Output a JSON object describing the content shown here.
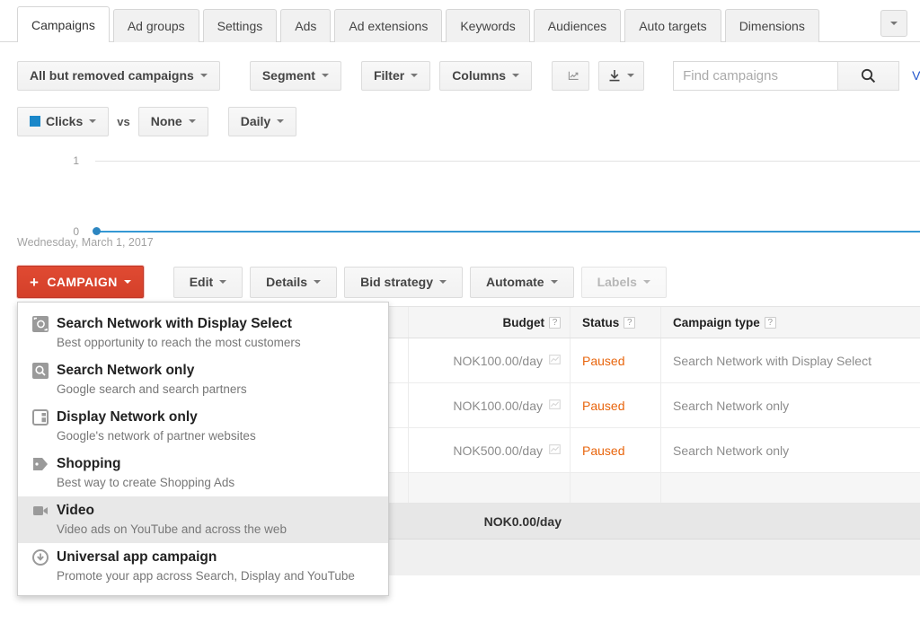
{
  "tabs": [
    {
      "label": "Campaigns",
      "active": true
    },
    {
      "label": "Ad groups",
      "active": false
    },
    {
      "label": "Settings",
      "active": false
    },
    {
      "label": "Ads",
      "active": false
    },
    {
      "label": "Ad extensions",
      "active": false
    },
    {
      "label": "Keywords",
      "active": false
    },
    {
      "label": "Audiences",
      "active": false
    },
    {
      "label": "Auto targets",
      "active": false
    },
    {
      "label": "Dimensions",
      "active": false
    }
  ],
  "toolbar": {
    "campaign_filter": "All but removed campaigns",
    "segment": "Segment",
    "filter": "Filter",
    "columns": "Columns",
    "chart_icon": "line-chart-icon",
    "download_icon": "download-icon",
    "search_placeholder": "Find campaigns",
    "search_value": "",
    "search_icon": "search-icon",
    "view_link": "V"
  },
  "metricbar": {
    "metric1": "Clicks",
    "metric1_color": "#1a87c9",
    "vs": "vs",
    "metric2": "None",
    "granularity": "Daily"
  },
  "chart_data": {
    "type": "line",
    "title": "",
    "xlabel": "",
    "ylabel": "Clicks",
    "categories": [
      "Wednesday, March 1, 2017"
    ],
    "x_tick_labels": [
      "Wednesday, March 1, 2017"
    ],
    "y_tick_labels": [
      "1",
      "0"
    ],
    "ylim": [
      0,
      1
    ],
    "grid": true,
    "legend": "Clicks",
    "series": [
      {
        "name": "Clicks",
        "color": "#3598d4",
        "values": [
          0
        ]
      }
    ]
  },
  "actionbar": {
    "new_campaign": "CAMPAIGN",
    "new_campaign_plus": "+",
    "edit": "Edit",
    "details": "Details",
    "bid_strategy": "Bid strategy",
    "automate": "Automate",
    "labels": "Labels"
  },
  "campaign_menu": {
    "items": [
      {
        "icon": "search-display-icon",
        "title": "Search Network with Display Select",
        "desc": "Best opportunity to reach the most customers",
        "hover": false
      },
      {
        "icon": "magnifier-icon",
        "title": "Search Network only",
        "desc": "Google search and search partners",
        "hover": false
      },
      {
        "icon": "display-layout-icon",
        "title": "Display Network only",
        "desc": "Google's network of partner websites",
        "hover": false
      },
      {
        "icon": "tag-icon",
        "title": "Shopping",
        "desc": "Best way to create Shopping Ads",
        "hover": false
      },
      {
        "icon": "video-camera-icon",
        "title": "Video",
        "desc": "Video ads on YouTube and across the web",
        "hover": true
      },
      {
        "icon": "app-download-icon",
        "title": "Universal app campaign",
        "desc": "Promote your app across Search, Display and YouTube",
        "hover": false
      }
    ]
  },
  "table": {
    "headers": {
      "budget": "Budget",
      "status": "Status",
      "campaign_type": "Campaign type",
      "help_glyph": "?"
    },
    "rows": [
      {
        "budget": "NOK100.00/day",
        "status": "Paused",
        "type": "Search Network with Display Select"
      },
      {
        "budget": "NOK100.00/day",
        "status": "Paused",
        "type": "Search Network only"
      },
      {
        "budget": "NOK500.00/day",
        "status": "Paused",
        "type": "Search Network only"
      }
    ],
    "total": {
      "budget": "NOK0.00/day",
      "status": "",
      "type": ""
    }
  }
}
